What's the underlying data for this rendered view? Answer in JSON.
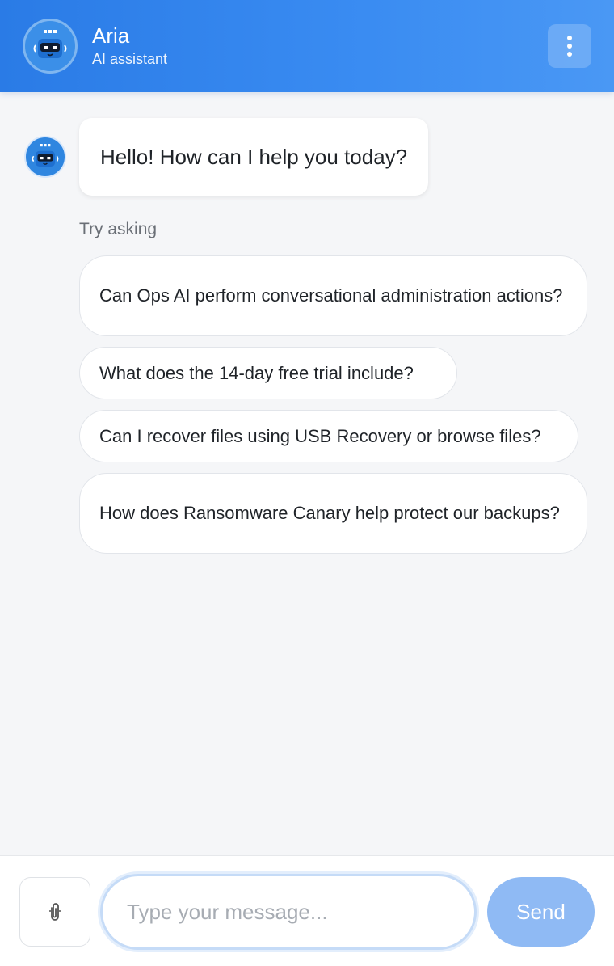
{
  "header": {
    "title": "Aria",
    "subtitle": "AI assistant",
    "avatar_icon": "robot-icon",
    "menu_icon": "kebab-menu-icon"
  },
  "messages": [
    {
      "role": "assistant",
      "text": "Hello! How can I help you today?"
    }
  ],
  "suggestions": {
    "label": "Try asking",
    "items": [
      "Can Ops AI perform conversational administration actions?",
      "What does the 14-day free trial include?",
      "Can I recover files using USB Recovery or browse files?",
      "How does Ransomware Canary help protect our backups?"
    ]
  },
  "composer": {
    "attach_icon": "paperclip-icon",
    "placeholder": "Type your message...",
    "value": "",
    "send_label": "Send"
  },
  "colors": {
    "header": "#2a7be6",
    "send_button": "#8fbaf4",
    "background": "#f5f6f8"
  }
}
